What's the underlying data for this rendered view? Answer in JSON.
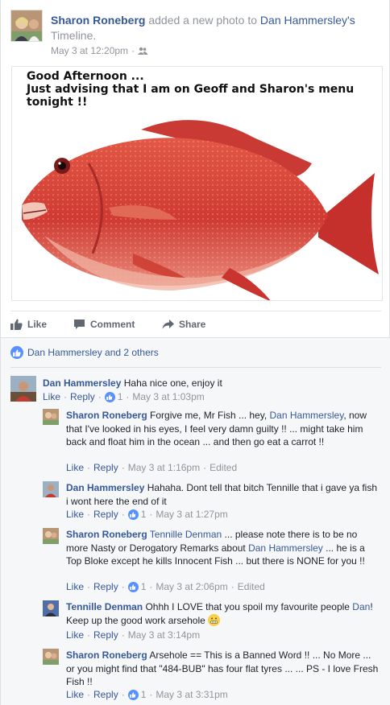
{
  "header": {
    "author": "Sharon Roneberg",
    "verb": " added a new photo to ",
    "target": "Dan Hammersley's",
    "target_suffix": " Timeline.",
    "time": "May 3 at 12:20pm"
  },
  "photo": {
    "caption_lines": [
      "Good Afternoon ...",
      "Just advising that I am on Geoff and Sharon's menu",
      "tonight !!"
    ]
  },
  "actions": {
    "like": "Like",
    "comment": "Comment",
    "share": "Share"
  },
  "likers": {
    "text": "Dan Hammersley and 2 others"
  },
  "comments": [
    {
      "author": "Dan Hammersley",
      "text": " Haha nice one, enjoy it",
      "like_label": "Like",
      "reply_label": "Reply",
      "like_count": "1",
      "time": "May 3 at 1:03pm"
    },
    {
      "author": "Sharon Roneberg",
      "text_a": " Forgive me, Mr Fish ... hey, ",
      "mention": "Dan Hammersley",
      "text_b": ", now that I've looked in his eyes, I feel very damn guilty !! ... might take him back and float him in the ocean ... and then go eat a carrot !!",
      "like_label": "Like",
      "reply_label": "Reply",
      "time": "May 3 at 1:16pm",
      "edited": "Edited"
    },
    {
      "author": "Dan Hammersley",
      "text": " Hahaha. Dont tell that bitch Tennille that i gave ya fish i wont here the end of it",
      "like_label": "Like",
      "reply_label": "Reply",
      "like_count": "1",
      "time": "May 3 at 1:27pm"
    },
    {
      "author": "Sharon Roneberg",
      "mention_a": " Tennille Denman",
      "text_a": " ... please note there is to be no more Nasty or Derogatory Remarks about ",
      "mention_b": "Dan Hammersley",
      "text_b": " ... he is a Top Bloke except he kills Innocent Fish ... but there is NONE for you !!",
      "like_label": "Like",
      "reply_label": "Reply",
      "like_count": "1",
      "time": "May 3 at 2:06pm",
      "edited": "Edited"
    },
    {
      "author": "Tennille Denman",
      "text_a": " Ohhh I LOVE that you spoil my favourite people ",
      "mention": "Dan",
      "text_b": "! Keep up the good work arsehole ",
      "like_label": "Like",
      "reply_label": "Reply",
      "time": "May 3 at 3:14pm"
    },
    {
      "author": "Sharon Roneberg",
      "text": " Arsehole == This is a Banned Word !! ... No More ... or you might find that \"484-BUB\" has four flat tyres ... ... PS - I love Fresh Fish !!",
      "like_label": "Like",
      "reply_label": "Reply",
      "like_count": "1",
      "time": "May 3 at 3:31pm"
    }
  ],
  "colors": {
    "link": "#365899",
    "muted": "#90949c",
    "like_blue": "#5890ff",
    "fish_red": "#d23c3c"
  }
}
